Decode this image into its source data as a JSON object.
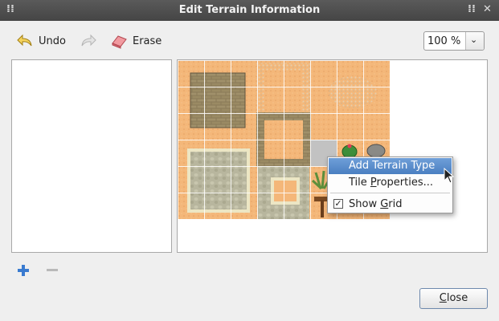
{
  "window": {
    "title": "Edit Terrain Information",
    "title_icon": "grip-icon",
    "control_icons": [
      "menu-grip-icon",
      "close-icon"
    ]
  },
  "toolbar": {
    "undo_label": "Undo",
    "redo_icon": "redo-arrow-icon",
    "erase_label": "Erase",
    "zoom_value": "100 %"
  },
  "context_menu": {
    "items": [
      {
        "label": "Add Terrain Type",
        "highlighted": true
      },
      {
        "label_pre": "Tile ",
        "label_u": "P",
        "label_post": "roperties..."
      },
      {
        "label_pre": "Show ",
        "label_u": "G",
        "label_post": "rid",
        "checked": true
      }
    ]
  },
  "footer": {
    "add_icon": "plus-icon",
    "remove_icon": "minus-icon",
    "close_u": "C",
    "close_rest": "lose"
  },
  "colors": {
    "titlebar": "#4f4f4f",
    "highlight": "#5b8bd0",
    "sand": "#f4b779"
  }
}
